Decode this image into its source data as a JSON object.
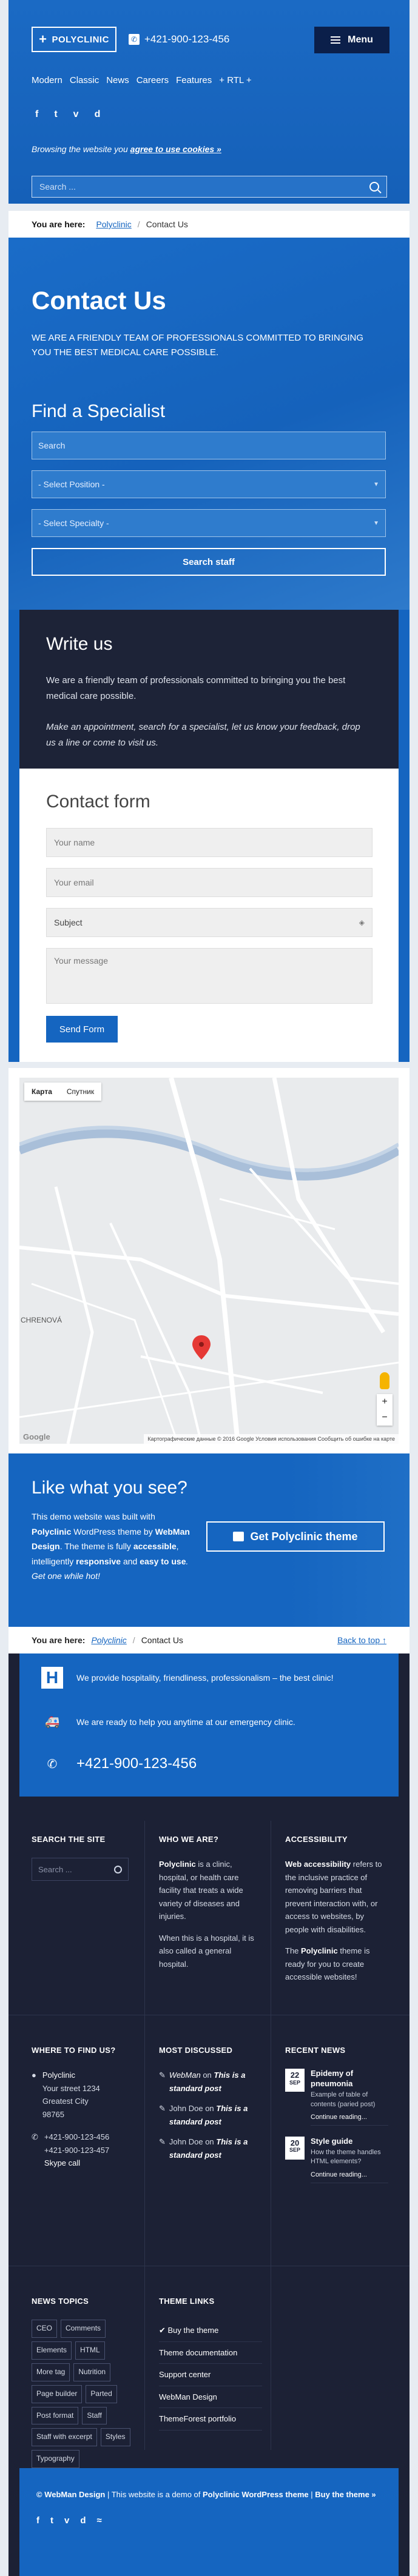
{
  "header": {
    "logo_label": "POLYCLINIC",
    "phone": "+421-900-123-456",
    "menu_label": "Menu",
    "nav": [
      "Modern",
      "Classic",
      "News",
      "Careers",
      "Features",
      "+ RTL +"
    ],
    "socials": [
      "f",
      "t",
      "v",
      "d"
    ],
    "cookie_prefix": "Browsing the website you",
    "cookie_link": "agree to use cookies »",
    "search_placeholder": "Search ..."
  },
  "breadcrumb": {
    "label": "You are here:",
    "home": "Polyclinic",
    "sep": "/",
    "current": "Contact Us"
  },
  "hero": {
    "title": "Contact Us",
    "subtitle": "WE ARE A FRIENDLY TEAM OF PROFESSIONALS COMMITTED TO BRINGING YOU THE BEST MEDICAL CARE POSSIBLE.",
    "find_title": "Find a Specialist",
    "search_placeholder": "Search",
    "position_select": "- Select Position -",
    "specialty_select": "- Select Specialty -",
    "search_button": "Search staff"
  },
  "write": {
    "title": "Write us",
    "text1": "We are a friendly team of professionals committed to bringing you the best medical care possible.",
    "text2": "Make an appointment, search for a specialist, let us know your feedback, drop us a line or come to visit us."
  },
  "form": {
    "title": "Contact form",
    "name_placeholder": "Your name",
    "email_placeholder": "Your email",
    "subject_value": "Subject",
    "message_placeholder": "Your message",
    "send_label": "Send Form"
  },
  "map": {
    "tab_map": "Карта",
    "tab_satellite": "Спутник",
    "attribution": "Картографические данные © 2016 Google   Условия использования   Сообщить об ошибке на карте",
    "google": "Google",
    "place_label": "CHRENOVÁ"
  },
  "cta": {
    "title": "Like what you see?",
    "text_a": "This demo website was built with ",
    "text_b": "Polyclinic",
    "text_c": " WordPress theme by ",
    "text_d": "WebMan Design",
    "text_e": ". The theme is fully ",
    "text_f": "accessible",
    "text_g": ", intelligently ",
    "text_h": "responsive",
    "text_i": " and ",
    "text_j": "easy to use",
    "text_k": ". Get one while hot!",
    "button_label": "Get Polyclinic theme"
  },
  "breadcrumb2": {
    "label": "You are here:",
    "home": "Polyclinic",
    "sep": "/",
    "current": "Contact Us",
    "back_to_top": "Back to top ↑"
  },
  "footer": {
    "badge_letter": "H",
    "line1": "We provide hospitality, friendliness, professionalism – the best clinic!",
    "line2": "We are ready to help you anytime at our emergency clinic.",
    "phone": "+421-900-123-456",
    "search_title": "SEARCH THE SITE",
    "search_placeholder": "Search ...",
    "who_title": "WHO WE ARE?",
    "who_b": "Polyclinic",
    "who_text1": " is a clinic, hospital, or health care facility that treats a wide variety of diseases and injuries.",
    "who_text2": "When this is a hospital, it is also called a general hospital.",
    "acc_title": "ACCESSIBILITY",
    "acc_b": "Web accessibility",
    "acc_text1": " refers to the inclusive practice of removing barriers that prevent interaction with, or access to websites, by people with disabilities.",
    "acc_pre": "The ",
    "acc_b2": "Polyclinic",
    "acc_text2": " theme is ready for you to create accessible websites!",
    "where_title": "WHERE TO FIND US?",
    "addr_name": "Polyclinic",
    "addr1": "Your street 1234",
    "addr2": "Greatest City",
    "addr3": "98765",
    "phone1": "+421-900-123-456",
    "phone2": "+421-900-123-457",
    "skype": "Skype call",
    "disc_title": "MOST DISCUSSED",
    "disc": [
      {
        "author": "WebMan",
        "post": "This is a standard post"
      },
      {
        "author": "John Doe",
        "post": "This is a standard post"
      },
      {
        "author": "John Doe",
        "post": "This is a standard post"
      }
    ],
    "disc_on": "on",
    "news_title": "RECENT NEWS",
    "news": [
      {
        "day": "22",
        "mon": "SEP",
        "title": "Epidemy of pneumonia",
        "excerpt": "Example of table of contents (paried post)",
        "more": "Continue reading..."
      },
      {
        "day": "20",
        "mon": "SEP",
        "title": "Style guide",
        "excerpt": "How the theme handles HTML elements?",
        "more": "Continue reading..."
      }
    ],
    "topics_title": "NEWS TOPICS",
    "tags": [
      "CEO",
      "Comments",
      "Elements",
      "HTML",
      "More tag",
      "Nutrition",
      "Page builder",
      "Parted",
      "Post format",
      "Staff",
      "Staff with excerpt",
      "Styles",
      "Typography"
    ],
    "links_title": "THEME LINKS",
    "links": [
      "Buy the theme",
      "Theme documentation",
      "Support center",
      "WebMan Design",
      "ThemeForest portfolio"
    ],
    "copy_b1": "© WebMan Design",
    "copy_mid": " | This website is a demo of ",
    "copy_b2": "Polyclinic WordPress theme",
    "copy_sep": " | ",
    "copy_b3": "Buy the theme »",
    "copy_socials": [
      "f",
      "t",
      "v",
      "d",
      "≈"
    ]
  },
  "colors": {
    "primary": "#1565c0",
    "dark": "#1c2135",
    "navy": "#0b1f4a"
  }
}
